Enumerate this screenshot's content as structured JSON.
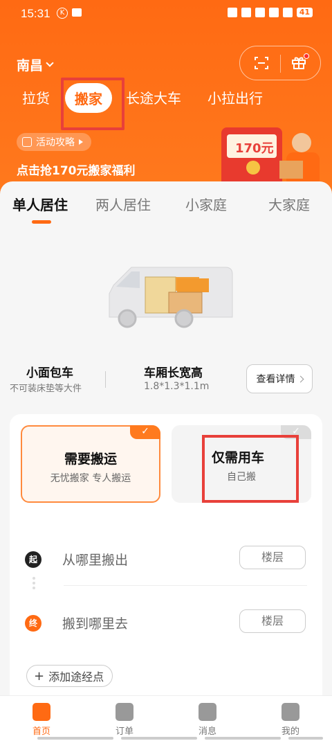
{
  "status_bar": {
    "time": "15:31",
    "battery": "41"
  },
  "header": {
    "city": "南昌",
    "main_tabs": [
      {
        "label": "拉货",
        "active": false
      },
      {
        "label": "搬家",
        "active": true
      },
      {
        "label": "长途大车",
        "active": false
      },
      {
        "label": "小拉出行",
        "active": false
      }
    ],
    "promo": {
      "pill_label": "活动攻略",
      "headline": "点击抢170元搬家福利",
      "coupon_text": "170元"
    }
  },
  "household_tabs": [
    {
      "label": "单人居住",
      "active": true
    },
    {
      "label": "两人居住",
      "active": false
    },
    {
      "label": "小家庭",
      "active": false
    },
    {
      "label": "大家庭",
      "active": false
    }
  ],
  "vehicle": {
    "name": "小面包车",
    "note": "不可装床垫等大件",
    "dimension_label": "车厢长宽高",
    "dimension_value": "1.8*1.3*1.1m",
    "detail_button": "查看详情"
  },
  "service_options": [
    {
      "title": "需要搬运",
      "subtitle": "无忧搬家 专人搬运",
      "selected": true
    },
    {
      "title": "仅需用车",
      "subtitle": "自己搬",
      "selected": false
    }
  ],
  "address": {
    "start_badge": "起",
    "start_placeholder": "从哪里搬出",
    "end_badge": "终",
    "end_placeholder": "搬到哪里去",
    "floor_label": "楼层",
    "add_stop": "添加途经点"
  },
  "bottom_nav": [
    {
      "label": "首页",
      "icon": "truck-icon",
      "active": true
    },
    {
      "label": "订单",
      "icon": "document-icon",
      "active": false
    },
    {
      "label": "消息",
      "icon": "chat-icon",
      "active": false
    },
    {
      "label": "我的",
      "icon": "person-icon",
      "active": false
    }
  ],
  "colors": {
    "brand": "#ff6a13",
    "highlight_box": "#e8403a"
  }
}
